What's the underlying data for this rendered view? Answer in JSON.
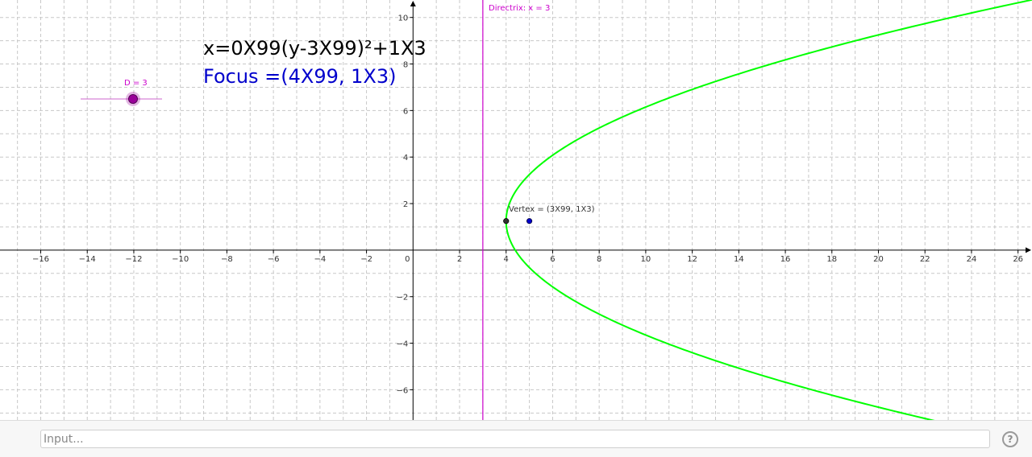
{
  "graph": {
    "x_tick_labels": [
      "−16",
      "−14",
      "−12",
      "−10",
      "−8",
      "−6",
      "−4",
      "−2",
      "0",
      "2",
      "4",
      "6",
      "8",
      "10",
      "12",
      "14",
      "16",
      "18",
      "20",
      "22",
      "24",
      "26"
    ],
    "y_tick_labels": [
      "10",
      "8",
      "6",
      "4",
      "2",
      "−2",
      "−4",
      "−6"
    ],
    "x_range": [
      -17.75,
      26.6
    ],
    "y_range": [
      -7.3,
      10.75
    ],
    "grid": true,
    "colors": {
      "parabola": "#00ff00",
      "directrix": "#cc00cc",
      "focus": "#0000cc",
      "vertex": "#333333",
      "slider": "#990099",
      "equation": "#000000"
    }
  },
  "equation": "x=0X99(y-3X99)²+1X3",
  "focus_label": "Focus =(4X99, 1X3)",
  "slider": {
    "label": "D = 3",
    "value": 3
  },
  "directrix_label": "Directrix: x = 3",
  "vertex_label": "Vertex = (3X99, 1X3)",
  "points": {
    "vertex": {
      "x": 4,
      "y": 1.25
    },
    "focus": {
      "x": 5,
      "y": 1.25
    }
  },
  "directrix": {
    "x": 3
  },
  "input": {
    "placeholder": "Input..."
  },
  "help_icon": "question-mark-icon",
  "help_glyph": "?"
}
